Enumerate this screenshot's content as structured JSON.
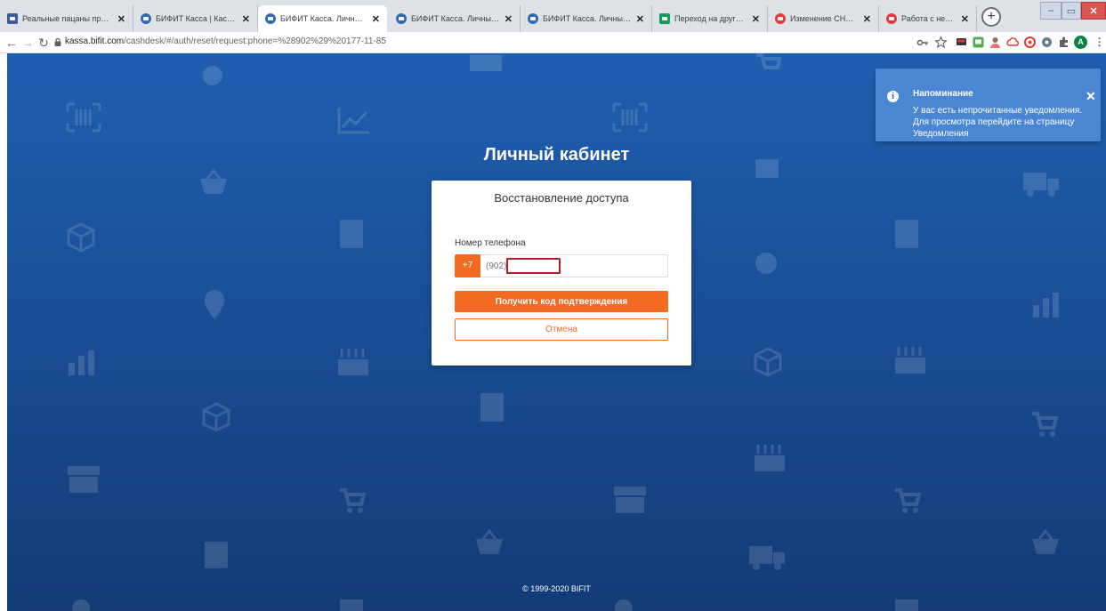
{
  "browser": {
    "tabs": [
      {
        "label": "Реальные пацаны против :",
        "favicon_color": "#3b5998"
      },
      {
        "label": "БИФИТ Касса | Кассовая пр",
        "favicon_color": "#2e6ab8"
      },
      {
        "label": "БИФИТ Касса. Личный каби",
        "favicon_color": "#2e6ab8",
        "active": true
      },
      {
        "label": "БИФИТ Касса. Личный каби",
        "favicon_color": "#2e6ab8"
      },
      {
        "label": "БИФИТ Касса. Личный каби",
        "favicon_color": "#2e6ab8"
      },
      {
        "label": "Переход на другую СНО с",
        "favicon_color": "#0f9d58"
      },
      {
        "label": "Изменение СНО – База зна",
        "favicon_color": "#e53935"
      },
      {
        "label": "Работа с несколькими СНО",
        "favicon_color": "#e53935"
      }
    ],
    "url_domain": "kassa.bifit.com",
    "url_path": "/cashdesk/#/auth/reset/request:phone=%28902%29%20177-11-85",
    "profile_initial": "A"
  },
  "page": {
    "title": "Личный кабинет",
    "card": {
      "title": "Восстановление доступа",
      "phone_label": "Номер телефона",
      "phone_prefix": "+7",
      "phone_value": "(902)",
      "submit_label": "Получить код подтверждения",
      "cancel_label": "Отмена"
    },
    "footer": "© 1999-2020 BIFIT"
  },
  "notification": {
    "title": "Напоминание",
    "body": "У вас есть непрочитанные уведомления. Для просмотра перейдите на страницу Уведомления",
    "icon": "info-icon"
  },
  "colors": {
    "accent": "#f26b21",
    "background": "#1a4f97",
    "toast": "#4b86d3"
  }
}
